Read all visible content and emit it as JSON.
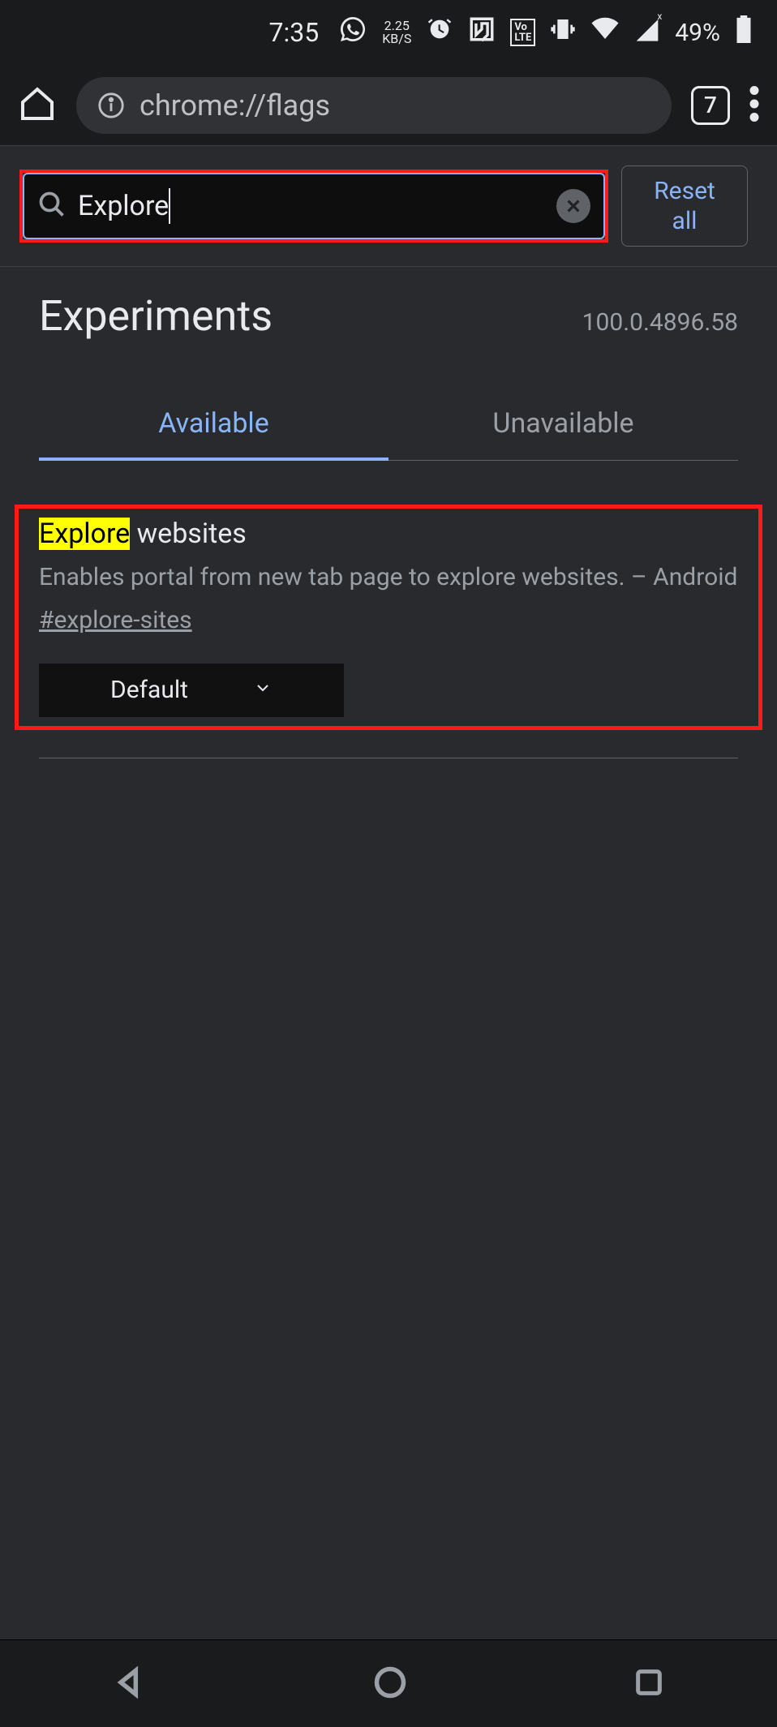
{
  "status": {
    "time": "7:35",
    "kbs_top": "2.25",
    "kbs_bottom": "KB/S",
    "volte": "Vo\nLTE",
    "battery_pct": "49%"
  },
  "browser": {
    "url": "chrome://flags",
    "tab_count": "7"
  },
  "search": {
    "value": "Explore",
    "reset_label": "Reset\nall"
  },
  "page": {
    "title": "Experiments",
    "version": "100.0.4896.58"
  },
  "tabs": {
    "available": "Available",
    "unavailable": "Unavailable"
  },
  "flag": {
    "title_highlight": "Explore",
    "title_rest": " websites",
    "description": "Enables portal from new tab page to explore websites. – Android",
    "anchor": "#explore-sites",
    "select_value": "Default"
  }
}
